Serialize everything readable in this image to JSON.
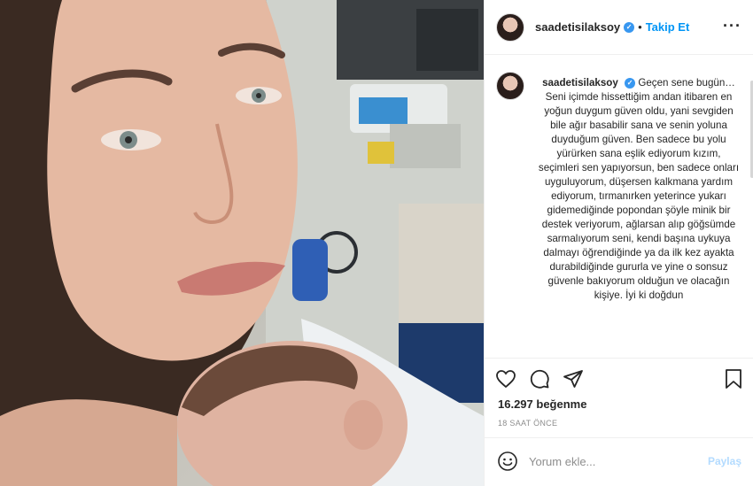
{
  "post": {
    "username": "saadetisilaksoy",
    "verified_mark": "✓",
    "follow_label": "Takip Et",
    "more_icon": "more-options-icon",
    "caption": {
      "username": "saadetisilaksoy",
      "text": "Geçen sene bugün… Seni içimde hissettiğim andan itibaren en yoğun duygum güven oldu, yani sevgiden bile ağır basabilir sana ve senin yoluna duyduğum güven. Ben sadece bu yolu yürürken sana eşlik ediyorum kızım, seçimleri sen yapıyorsun, ben sadece onları uyguluyorum, düşersen kalkmana yardım ediyorum, tırmanırken yeterince yukarı gidemediğinde popondan şöyle minik bir destek veriyorum, ağlarsan alıp göğsümde sarmalıyorum seni, kendi başına uykuya dalmayı öğrendiğinde ya da ilk kez ayakta durabildiğinde gururla ve yine o sonsuz güvenle bakıyorum olduğun ve olacağın kişiye. İyi ki doğdun"
    },
    "likes": "16.297 beğenme",
    "time_ago": "18 SAAT ÖNCE",
    "comment": {
      "placeholder": "Yorum ekle...",
      "share_label": "Paylaş"
    },
    "icons": [
      "heart-icon",
      "comment-icon",
      "share-icon",
      "bookmark-icon",
      "emoji-icon"
    ]
  },
  "colors": {
    "accent": "#0095f6",
    "verified": "#3897f0",
    "muted": "#8e8e8e",
    "share_disabled": "#b3dbff"
  }
}
